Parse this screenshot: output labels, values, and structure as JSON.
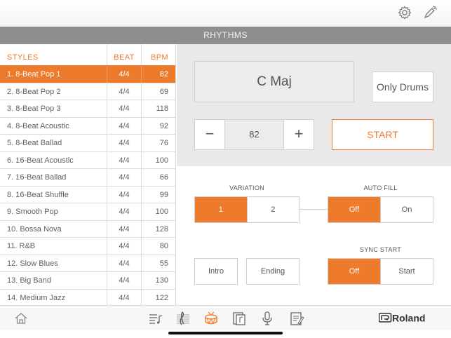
{
  "header": {
    "title": "RHYTHMS"
  },
  "top_icons": [
    "gear-icon",
    "pen-bluetooth-icon"
  ],
  "list": {
    "headers": {
      "styles": "STYLES",
      "beat": "BEAT",
      "bpm": "BPM"
    },
    "rows": [
      {
        "name": "1. 8-Beat Pop 1",
        "beat": "4/4",
        "bpm": "82",
        "selected": true
      },
      {
        "name": "2. 8-Beat Pop 2",
        "beat": "4/4",
        "bpm": "69"
      },
      {
        "name": "3. 8-Beat Pop 3",
        "beat": "4/4",
        "bpm": "118"
      },
      {
        "name": "4. 8-Beat Acoustic",
        "beat": "4/4",
        "bpm": "92"
      },
      {
        "name": "5. 8-Beat Ballad",
        "beat": "4/4",
        "bpm": "76"
      },
      {
        "name": "6. 16-Beat Acoustic",
        "beat": "4/4",
        "bpm": "100"
      },
      {
        "name": "7. 16-Beat Ballad",
        "beat": "4/4",
        "bpm": "66"
      },
      {
        "name": "8. 16-Beat Shuffle",
        "beat": "4/4",
        "bpm": "99"
      },
      {
        "name": "9. Smooth Pop",
        "beat": "4/4",
        "bpm": "100"
      },
      {
        "name": "10. Bossa Nova",
        "beat": "4/4",
        "bpm": "128"
      },
      {
        "name": "11. R&B",
        "beat": "4/4",
        "bpm": "80"
      },
      {
        "name": "12. Slow Blues",
        "beat": "4/4",
        "bpm": "55"
      },
      {
        "name": "13. Big Band",
        "beat": "4/4",
        "bpm": "130"
      },
      {
        "name": "14. Medium Jazz",
        "beat": "4/4",
        "bpm": "122"
      }
    ]
  },
  "controls": {
    "chord": "C Maj",
    "only_drums": "Only Drums",
    "tempo": {
      "minus": "−",
      "value": "82",
      "plus": "+"
    },
    "start": "START",
    "variation": {
      "label": "VARIATION",
      "options": [
        "1",
        "2"
      ],
      "selected": "1"
    },
    "auto_fill": {
      "label": "AUTO FILL",
      "options": [
        "Off",
        "On"
      ],
      "selected": "Off"
    },
    "intro": "Intro",
    "ending": "Ending",
    "sync_start": {
      "label": "SYNC START",
      "options": [
        "Off",
        "Start"
      ],
      "selected": "Off"
    }
  },
  "bottom_nav": {
    "items": [
      "home-icon",
      "playlist-icon",
      "score-icon",
      "rhythm-drum-icon",
      "songbook-icon",
      "microphone-icon",
      "notepad-icon"
    ],
    "active": "rhythm-drum-icon",
    "brand": "Roland"
  },
  "colors": {
    "accent": "#ee7a2c",
    "header_bg": "#8e8e8e",
    "panel_bg": "#e9e9e9"
  }
}
